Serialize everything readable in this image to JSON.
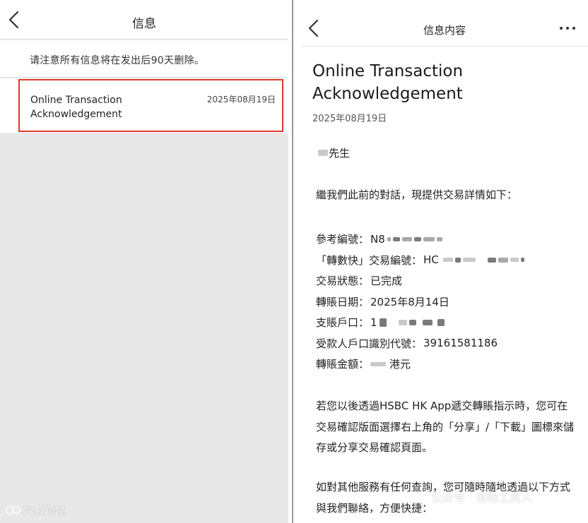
{
  "left": {
    "title": "信息",
    "notice": "请注意所有信息将在发出后90天删除。",
    "items": [
      {
        "title": "Online Transaction Acknowledgement",
        "date": "2025年08月19日"
      }
    ],
    "watermark": "六數跨境"
  },
  "right": {
    "title": "信息内容",
    "message": {
      "title": "Online Transaction Acknowledgement",
      "date": "2025年08月19日",
      "greeting_suffix": "先生",
      "intro": "繼我們此前的對話，現提供交易詳情如下：",
      "details": [
        {
          "label": "參考編號：",
          "value": "N8"
        },
        {
          "label": "「轉數快」交易編號：",
          "value": "HC"
        },
        {
          "label": "交易狀態：",
          "value": "已完成"
        },
        {
          "label": "轉賬日期：",
          "value": "2025年8月14日"
        },
        {
          "label": "支賬戶口：",
          "value": "1"
        },
        {
          "label": "受款人戶口識別代號：",
          "value": "39161581186"
        },
        {
          "label": "轉賬金額：",
          "value": "港元"
        }
      ],
      "para1": "若您以後透過HSBC HK App遞交轉賬指示時，您可在交易確認版面選擇右上角的「分享」/「下載」圖標來儲存或分享交易確認頁面。",
      "para2": "如對其他服務有任何查詢，您可隨時隨地透過以下方式與我們聯絡，方便快捷："
    },
    "watermark": "公众号 · 港险工具人"
  },
  "colors": {
    "highlight_border": "#d93a2b",
    "list_background": "#e8e8e8"
  },
  "icons": {
    "back": "chevron-left-icon",
    "more": "more-dots-icon"
  }
}
